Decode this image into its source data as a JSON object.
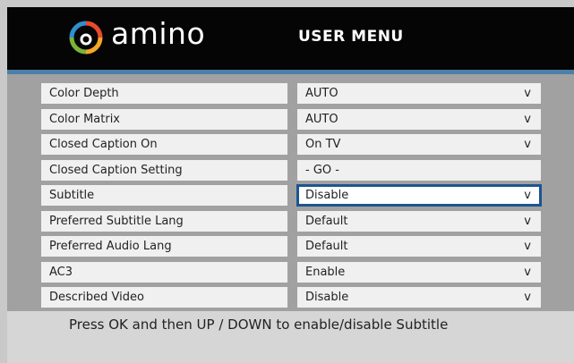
{
  "header": {
    "brand": "amino",
    "title": "USER MENU",
    "logo_colors": [
      "#e94b2f",
      "#f5a623",
      "#7ab33a",
      "#2f8fd1"
    ]
  },
  "settings": [
    {
      "label": "Color Depth",
      "value": "AUTO",
      "dropdown": true,
      "selected": false
    },
    {
      "label": "Color Matrix",
      "value": "AUTO",
      "dropdown": true,
      "selected": false
    },
    {
      "label": "Closed Caption On",
      "value": "On TV",
      "dropdown": true,
      "selected": false
    },
    {
      "label": "Closed Caption Setting",
      "value": "- GO -",
      "dropdown": false,
      "selected": false
    },
    {
      "label": "Subtitle",
      "value": "Disable",
      "dropdown": true,
      "selected": true
    },
    {
      "label": "Preferred Subtitle Lang",
      "value": "Default",
      "dropdown": true,
      "selected": false
    },
    {
      "label": "Preferred Audio Lang",
      "value": "Default",
      "dropdown": true,
      "selected": false
    },
    {
      "label": "AC3",
      "value": "Enable",
      "dropdown": true,
      "selected": false
    },
    {
      "label": "Described Video",
      "value": "Disable",
      "dropdown": true,
      "selected": false
    }
  ],
  "dropdown_glyph": "v",
  "footer": {
    "hint": "Press OK and then UP / DOWN to enable/disable Subtitle"
  }
}
